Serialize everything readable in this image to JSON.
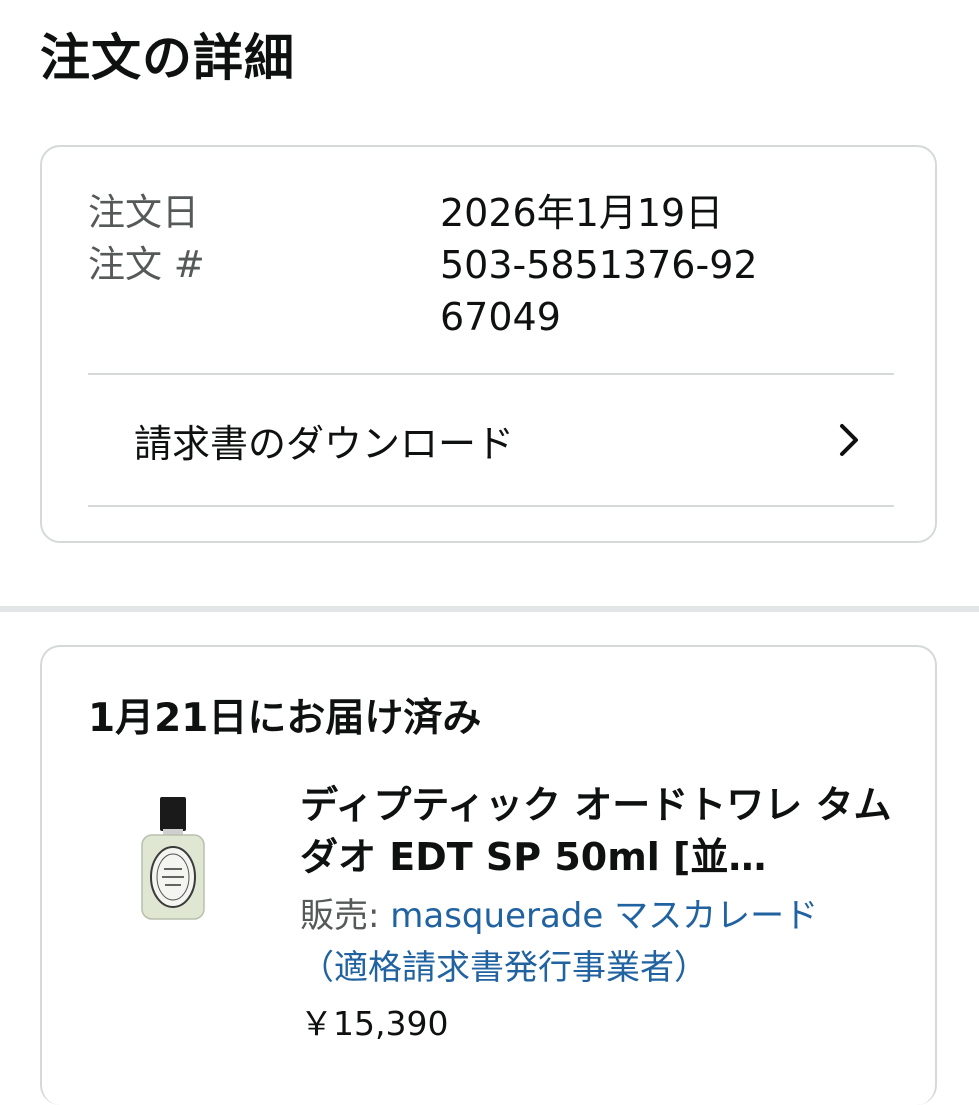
{
  "page_title": "注文の詳細",
  "order": {
    "date_label": "注文日",
    "date_value": "2026年1月19日",
    "number_label": "注文 #",
    "number_value": "503-5851376-9267049",
    "download_label": "請求書のダウンロード"
  },
  "delivery": {
    "status": "1月21日にお届け済み",
    "product": {
      "title": "ディプティック オードトワレ タムダオ EDT SP 50ml [並…",
      "seller_prefix": "販売: ",
      "seller_name": "masquerade マスカレード（適格請求書発行事業者）",
      "price": "￥15,390",
      "image_icon": "perfume-bottle-icon"
    }
  },
  "colors": {
    "link": "#2162a1",
    "secondary_text": "#565959",
    "border": "#d5d9d9"
  }
}
